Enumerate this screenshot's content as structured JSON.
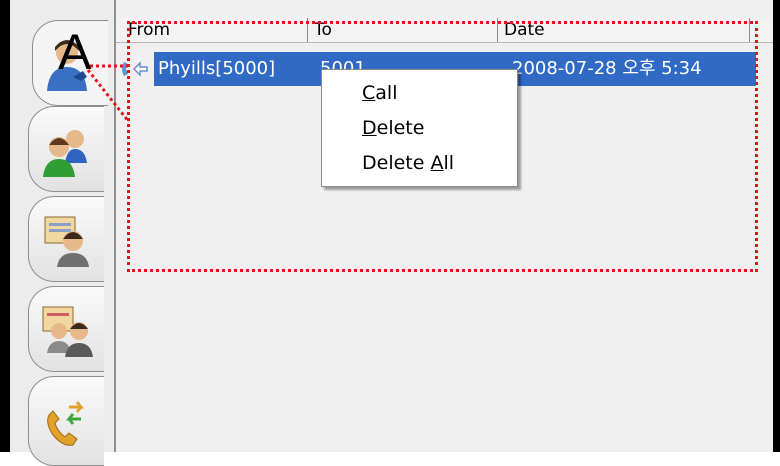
{
  "table": {
    "columns": [
      "From",
      "To",
      "Date"
    ],
    "rows": [
      {
        "from": "Phyills[5000]",
        "to": "5001",
        "date": "2008-07-28 오후 5:34",
        "selected": true
      }
    ]
  },
  "context_menu": {
    "items": [
      {
        "mnemonic": "C",
        "rest": "all"
      },
      {
        "mnemonic": "D",
        "rest": "elete"
      },
      {
        "prefix": "Delete ",
        "mnemonic": "A",
        "rest": "ll"
      }
    ]
  },
  "annotation": {
    "label": "A",
    "color": "#e0141b"
  },
  "colors": {
    "selection": "#316ac5"
  }
}
